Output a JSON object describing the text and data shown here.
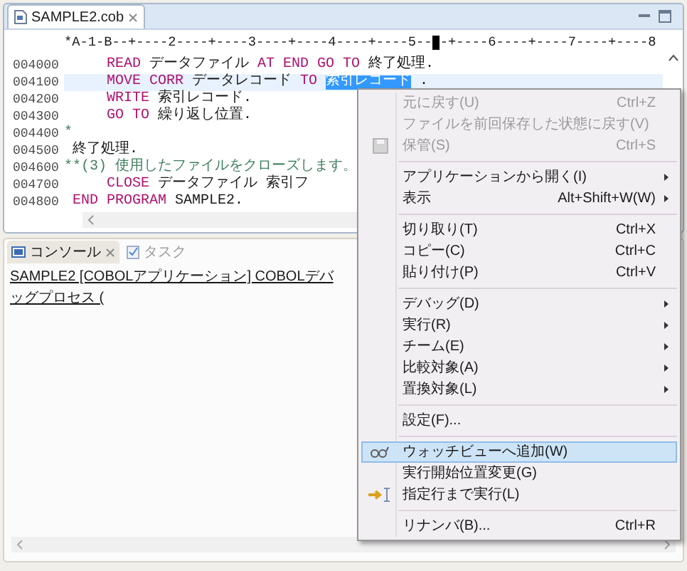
{
  "editor": {
    "tabs": [
      {
        "label": "SAMPLE2.cob",
        "selected": true
      }
    ],
    "ruler": {
      "before": "*A-1-B--+----2----+----3----+----4----+----5--",
      "after": "-+----6----+----7----+----8"
    },
    "lines": [
      {
        "number": "004000",
        "kind": "statement",
        "current": false,
        "segments": [
          {
            "kind": "keyword",
            "text": "READ"
          },
          {
            "kind": "text",
            "text": "データファイル"
          },
          {
            "kind": "keyword",
            "text": "AT END GO TO"
          },
          {
            "kind": "text",
            "text": "終了処理."
          }
        ]
      },
      {
        "number": "004100",
        "kind": "statement",
        "current": true,
        "segments": [
          {
            "kind": "keyword",
            "text": "MOVE CORR"
          },
          {
            "kind": "text",
            "text": "データレコード"
          },
          {
            "kind": "keyword",
            "text": "TO"
          },
          {
            "kind": "selected",
            "text": "索引レコード"
          },
          {
            "kind": "text",
            "text": "."
          }
        ]
      },
      {
        "number": "004200",
        "kind": "statement",
        "current": false,
        "segments": [
          {
            "kind": "keyword",
            "text": "WRITE"
          },
          {
            "kind": "text",
            "text": "索引レコード."
          }
        ]
      },
      {
        "number": "004300",
        "kind": "statement",
        "current": false,
        "segments": [
          {
            "kind": "keyword",
            "text": "GO TO"
          },
          {
            "kind": "text",
            "text": "繰り返し位置."
          }
        ]
      },
      {
        "number": "004400",
        "kind": "comment",
        "current": false,
        "segments": [
          {
            "kind": "comment",
            "text": "*"
          }
        ]
      },
      {
        "number": "004500",
        "kind": "paragraph",
        "current": false,
        "segments": [
          {
            "kind": "text",
            "text": "終了処理."
          }
        ]
      },
      {
        "number": "004600",
        "kind": "comment",
        "current": false,
        "segments": [
          {
            "kind": "comment",
            "text": "**(3) 使用したファイルをクローズします。"
          }
        ]
      },
      {
        "number": "004700",
        "kind": "statement",
        "current": false,
        "segments": [
          {
            "kind": "keyword",
            "text": "CLOSE"
          },
          {
            "kind": "text",
            "text": "データファイル"
          },
          {
            "kind": "text",
            "text": "索引フ"
          }
        ]
      },
      {
        "number": "004800",
        "kind": "paragraph",
        "current": false,
        "segments": [
          {
            "kind": "keyword",
            "text": "END PROGRAM"
          },
          {
            "kind": "text",
            "text": "SAMPLE2."
          }
        ]
      }
    ]
  },
  "console": {
    "tabs": [
      {
        "label": "コンソール",
        "selected": true
      },
      {
        "label": "タスク",
        "selected": false
      }
    ],
    "text": "SAMPLE2 [COBOLアプリケーション] COBOLデバッグプロセス ("
  },
  "menu": {
    "groups": [
      {
        "items": [
          {
            "label": "元に戻す(U)",
            "shortcut": "Ctrl+Z",
            "kind": "plain",
            "disabled": true,
            "submenu": false,
            "selected": false
          },
          {
            "label": "ファイルを前回保存した状態に戻す(V)",
            "kind": "plain",
            "disabled": true,
            "submenu": false,
            "selected": false
          },
          {
            "label": "保管(S)",
            "shortcut": "Ctrl+S",
            "kind": "disk",
            "disabled": true,
            "submenu": false,
            "selected": false
          }
        ]
      },
      {
        "items": [
          {
            "label": "アプリケーションから開く(I)",
            "kind": "plain",
            "disabled": false,
            "submenu": true,
            "selected": false
          },
          {
            "label": "表示",
            "shortcut": "Alt+Shift+W(W)",
            "kind": "plain",
            "disabled": false,
            "submenu": true,
            "selected": false
          }
        ]
      },
      {
        "items": [
          {
            "label": "切り取り(T)",
            "shortcut": "Ctrl+X",
            "kind": "plain",
            "disabled": false,
            "submenu": false,
            "selected": false
          },
          {
            "label": "コピー(C)",
            "shortcut": "Ctrl+C",
            "kind": "plain",
            "disabled": false,
            "submenu": false,
            "selected": false
          },
          {
            "label": "貼り付け(P)",
            "shortcut": "Ctrl+V",
            "kind": "plain",
            "disabled": false,
            "submenu": false,
            "selected": false
          }
        ]
      },
      {
        "items": [
          {
            "label": "デバッグ(D)",
            "kind": "plain",
            "disabled": false,
            "submenu": true,
            "selected": false
          },
          {
            "label": "実行(R)",
            "kind": "plain",
            "disabled": false,
            "submenu": true,
            "selected": false
          },
          {
            "label": "チーム(E)",
            "kind": "plain",
            "disabled": false,
            "submenu": true,
            "selected": false
          },
          {
            "label": "比較対象(A)",
            "kind": "plain",
            "disabled": false,
            "submenu": true,
            "selected": false
          },
          {
            "label": "置換対象(L)",
            "kind": "plain",
            "disabled": false,
            "submenu": true,
            "selected": false
          }
        ]
      },
      {
        "items": [
          {
            "label": "設定(F)...",
            "kind": "plain",
            "disabled": false,
            "submenu": false,
            "selected": false
          }
        ]
      },
      {
        "items": [
          {
            "label": "ウォッチビューへ追加(W)",
            "kind": "glasses",
            "disabled": false,
            "submenu": false,
            "selected": true
          },
          {
            "label": "実行開始位置変更(G)",
            "kind": "plain",
            "disabled": false,
            "submenu": false,
            "selected": false
          },
          {
            "label": "指定行まで実行(L)",
            "kind": "pointer",
            "disabled": false,
            "submenu": false,
            "selected": false
          }
        ]
      },
      {
        "items": [
          {
            "label": "リナンバ(B)...",
            "shortcut": "Ctrl+R",
            "kind": "plain",
            "disabled": false,
            "submenu": false,
            "selected": false
          }
        ]
      }
    ]
  }
}
